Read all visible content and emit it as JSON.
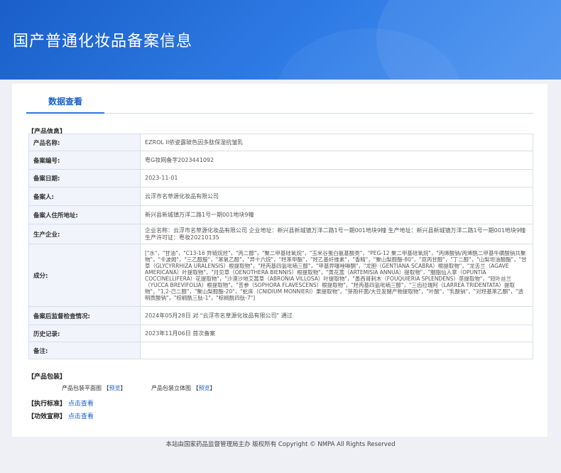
{
  "header": {
    "title": "国产普通化妆品备案信息"
  },
  "tabs": [
    {
      "label": "数据查看"
    }
  ],
  "product_info": {
    "section_label": "【产品信息】",
    "rows": [
      {
        "label": "产品名称:",
        "value": "EZROL II依姿露玻色因多肽保湿抗皱乳"
      },
      {
        "label": "备案编号:",
        "value": "粤G妆网备字2023441092"
      },
      {
        "label": "备案日期:",
        "value": "2023-11-01"
      },
      {
        "label": "备案人:",
        "value": "云浮市名草源化妆品有限公司"
      },
      {
        "label": "备案人住所地址:",
        "value": "新兴县新城镇万洋二路1号一期001地块9幢"
      },
      {
        "label": "生产企业:",
        "value": "企业名称：云浮市名草源化妆品有限公司 企业地址：新兴县新城镇万洋二路1号一期001地块9幢 生产地址：新兴县新城镇万洋二路1号一期001地块9幢 生产许可证：粤妆20210135"
      },
      {
        "label": "成分:",
        "value": "[\"水\"，\"甘油\"，\"C13-16 异链烷烃\"，\"丙二醇\"，\"聚二甲基硅氧烷\"，\"玉米谷蛋白氨基酸类\"，\"PEG-12 聚二甲基硅氧烷\"，\"丙烯酸钠/丙烯酰二甲基牛磺酸钠共聚物\"，\"卡波姆\"，\"三乙醇胺\"，\"苯氧乙醇\"，\"异十六烷\"，\"羟苯甲酯\"，\"羟乙基纤维素\"，\"香精\"，\"聚山梨醇酯-80\"，\"双丙甘醇\"，\"丁二醇\"，\"山梨坦油酸酯\"，\"甘草（GLYCYRRHIZA URALENSIS）根提取物\"，\"羟丙基四氢吡喃三醇\"，\"甲基异噻唑啉酮\"，\"龙胆（GENTIANA SCABRA）根提取物\"，\"龙舌兰（AGAVE AMERICANA）叶提取物\"，\"月见草（OENOTHERA BIENNIS）根提取物\"，\"黄花蒿（ARTEMISIA ANNUA）提取物\"，\"胭脂仙人掌（OPUNTIA COCCINELLIFERA）花提取物\"，\"沙漠沙地艾蒿草（ABRONIA VILLOSA）叶提取物\"，\"墨西哥刺木（FOUQUIERIA SPLENDENS）茎提取物\"，\"短叶丝兰（YUCCA BREVIFOLIA）根提取物\"，\"苦参（SOPHORA FLAVESCENS）根提取物\"，\"羟丙基四氢吡喃三醇\"，\"三齿拉瑞阿（LARREA TRIDENTATA）提取物\"，\"1,2-己二醇\"，\"聚山梨醇酯-20\"，\"蛇床（CNIDIUM MONNIERI）果提取物\"，\"芽孢杆菌/大豆发酵产物提取物\"，\"叶酸\"，\"乳酸钠\"，\"对羟基苯乙酮\"，\"透明质酸钠\"，\"棕榈酰三肽-1\"，\"棕榈酰四肽-7\"]"
      },
      {
        "label": "备案后监督检查情况:",
        "value": "2024年05月28日 对 \"云浮市名草源化妆品有限公司\" 通过"
      },
      {
        "label": "历史记录:",
        "value": "2023年11月06日 首次备案"
      },
      {
        "label": "备注:",
        "value": ""
      }
    ]
  },
  "package": {
    "section_label": "【产品包装】",
    "flat_label": "产品包装平面图",
    "flat_link": "预览",
    "solid_label": "产品包装立体图",
    "solid_link": "预览",
    "bracket_open": "【",
    "bracket_close": "】"
  },
  "standard": {
    "label": "【执行标准】",
    "link": "点击查看"
  },
  "efficacy": {
    "label": "【功效宣称】",
    "link": "点击查看"
  },
  "footer": {
    "text": "本站由国家药品监督管理局主办 版权所有 Copyright © NMPA All Rights Reserved"
  }
}
